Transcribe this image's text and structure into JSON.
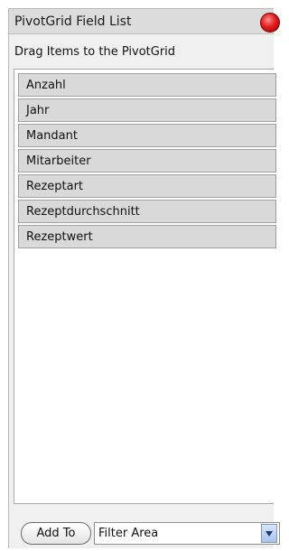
{
  "window": {
    "title": "PivotGrid Field List",
    "close_icon": "close-icon"
  },
  "instruction": "Drag Items to the PivotGrid",
  "fields": [
    "Anzahl",
    "Jahr",
    "Mandant",
    "Mitarbeiter",
    "Rezeptart",
    "Rezeptdurchschnitt",
    "Rezeptwert"
  ],
  "footer": {
    "add_to_label": "Add To",
    "area_value": "Filter Area",
    "dropdown_icon": "chevron-down-icon"
  },
  "colors": {
    "panel_bg": "#f0f0f0",
    "field_bg": "#d9d9d9",
    "close_red": "#e11e1e",
    "dropdown_blue": "#a9c3ec"
  }
}
